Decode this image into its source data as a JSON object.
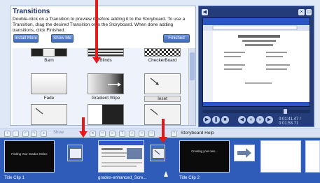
{
  "transitions_panel": {
    "title": "Transitions",
    "description": "Double-click on a Transition to preview it before adding it to the Storyboard. To use a Transition, drag the desired Transition onto the Storyboard. When done adding transitions, click Finished.",
    "buttons": {
      "install_more": "Install More",
      "show_me": "Show Me",
      "finished": "Finished"
    },
    "items": [
      {
        "label": "Barn",
        "selected": false
      },
      {
        "label": "Blinds",
        "selected": false
      },
      {
        "label": "CheckerBoard",
        "selected": false
      },
      {
        "label": "Fade",
        "selected": false
      },
      {
        "label": "Gradient Wipe",
        "selected": false
      },
      {
        "label": "Inset",
        "selected": true
      }
    ]
  },
  "preview": {
    "timecode": "0:01:41.47 / 0:01:53.71",
    "seek_fraction": 0.76
  },
  "toolbar": {
    "items": [
      "zoom-in-icon",
      "zoom-out-icon",
      "undo-icon",
      "redo-icon",
      "show-label",
      "split-icon",
      "effects-icon",
      "titles-icon",
      "music-icon",
      "narrate-icon",
      "clip-icon"
    ],
    "show_label": "Show",
    "help_label": "Storyboard Help"
  },
  "storyboard": {
    "clips": [
      {
        "label": "Title Clip 1",
        "caption": "Finding Your Grades Online"
      },
      {
        "label": "grades-enhanced_Scre...",
        "caption": ""
      },
      {
        "label": "Title Clip 2",
        "caption": "Creating your own..."
      }
    ]
  },
  "colors": {
    "accent": "#2f5cb8",
    "arrow": "#e21a1a",
    "monitor_bg": "#243d7a"
  }
}
